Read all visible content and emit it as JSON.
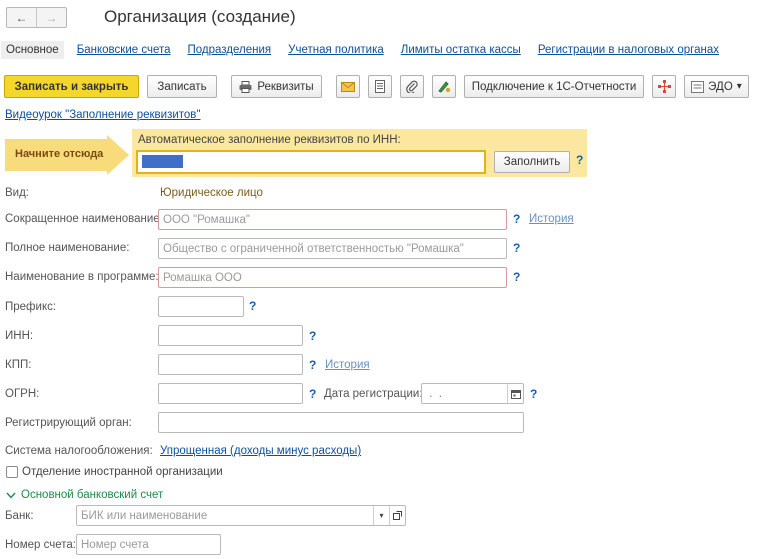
{
  "window": {
    "title": "Организация (создание)"
  },
  "nav": {
    "back": "←",
    "forward": "→"
  },
  "tabs": [
    "Основное",
    "Банковские счета",
    "Подразделения",
    "Учетная политика",
    "Лимиты остатка кассы",
    "Регистрации в налоговых органах"
  ],
  "toolbar": {
    "save_close": "Записать и закрыть",
    "save": "Записать",
    "requisites": "Реквизиты",
    "connect": "Подключение к 1С-Отчетности",
    "edo": "ЭДО",
    "edo_arrow": "▾"
  },
  "video_link": "Видеоурок \"Заполнение реквизитов\"",
  "autofill": {
    "start_here": "Начните отсюда",
    "label": "Автоматическое заполнение реквизитов по ИНН:",
    "fill_button": "Заполнить",
    "help": "?"
  },
  "form": {
    "kind_label": "Вид:",
    "kind_value": "Юридическое лицо",
    "short_name_label": "Сокращенное наименование:",
    "short_name_placeholder": "ООО \"Ромашка\"",
    "full_name_label": "Полное наименование:",
    "full_name_placeholder": "Общество с ограниченной ответственностью \"Ромашка\"",
    "program_name_label": "Наименование в программе:",
    "program_name_placeholder": "Ромашка ООО",
    "prefix_label": "Префикс:",
    "inn_label": "ИНН:",
    "kpp_label": "КПП:",
    "ogrn_label": "ОГРН:",
    "reg_date_label": "Дата регистрации:",
    "reg_date_value": " .  .",
    "reg_authority_label": "Регистрирующий орган:",
    "tax_system_label": "Система налогообложения:",
    "tax_system_value": "Упрощенная (доходы минус расходы)",
    "foreign_branch_label": "Отделение иностранной организации",
    "history": "История",
    "help": "?"
  },
  "bank_group": {
    "title": "Основной банковский счет",
    "bank_label": "Банк:",
    "bank_placeholder": "БИК или наименование",
    "account_label": "Номер счета:",
    "account_placeholder": "Номер счета"
  }
}
